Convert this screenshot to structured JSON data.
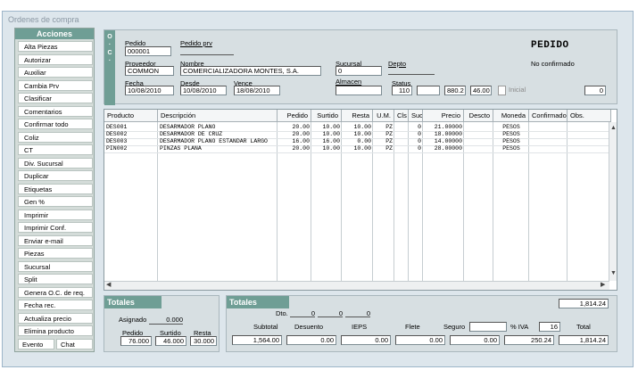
{
  "window_title": "Ordenes de compra",
  "sidebar": {
    "header": "Acciones",
    "items": [
      "Alta Piezas",
      "Autorizar",
      "Auxiliar",
      "Cambia Prv",
      "Clasificar",
      "Comentarios",
      "Confirmar todo",
      "Coliz",
      "CT",
      "Div. Sucursal",
      "Duplicar",
      "Etiquetas",
      "Gen %",
      "Imprimir",
      "Imprimir Conf.",
      "Enviar e-mail",
      "Piezas",
      "Sucursal",
      "Split",
      "Genera O.C. de req.",
      "Fecha rec.",
      "Actualiza precio",
      "Elimina producto"
    ],
    "bottom": [
      "Evento",
      "Chat"
    ]
  },
  "header": {
    "oc_letters": [
      "O",
      "C"
    ],
    "pedido_label": "Pedido",
    "pedido_value": "000001",
    "pedido_prv_label": "Pedido prv",
    "pedido_prv_value": "",
    "title": "PEDIDO",
    "proveedor_label": "Proveedor",
    "proveedor_value": "COMMON",
    "nombre_label": "Nombre",
    "nombre_value": "COMERCIALIZADORA MONTES, S.A.",
    "sucursal_label": "Sucursal",
    "sucursal_value": "0",
    "depto_label": "Depto",
    "depto_value": "",
    "status_text": "No confirmado",
    "fecha_label": "Fecha",
    "fecha_value": "10/08/2010",
    "desde_label": "Desde",
    "desde_value": "10/08/2010",
    "vence_label": "Vence",
    "vence_value": "18/08/2010",
    "almacen_label": "Almacen",
    "almacen_value": "",
    "status_label": "Status",
    "status_value": "110",
    "blank_value": "",
    "value_880": "880.2",
    "value_46": "46.00",
    "inicial_label": "Inicial",
    "right_value": "0"
  },
  "grid": {
    "columns": [
      "Producto",
      "Descripción",
      "Pedido",
      "Surtido",
      "Resta",
      "U.M.",
      "Cls",
      "Suc",
      "Precio",
      "Descto",
      "Moneda",
      "Confirmado",
      "Obs."
    ],
    "rows": [
      [
        "DES001",
        "DESARMADOR PLANO",
        "20.00",
        "10.00",
        "10.00",
        "PZ",
        "",
        "0",
        "21.00000",
        "",
        "PESOS",
        "",
        ""
      ],
      [
        "DES002",
        "DESARMADOR DE CRUZ",
        "20.00",
        "10.00",
        "10.00",
        "PZ",
        "",
        "0",
        "18.00000",
        "",
        "PESOS",
        "",
        ""
      ],
      [
        "DES003",
        "DESARMADOR PLANO ESTANDAR LARGO",
        "16.00",
        "16.00",
        "0.00",
        "PZ",
        "",
        "0",
        "14.00000",
        "",
        "PESOS",
        "",
        ""
      ],
      [
        "PIN002",
        "PINZAS PLANA",
        "20.00",
        "10.00",
        "10.00",
        "PZ",
        "",
        "0",
        "28.00000",
        "",
        "PESOS",
        "",
        ""
      ]
    ]
  },
  "totals_left": {
    "header": "Totales",
    "asignado_label": "Asignado",
    "asignado_value": "0.000",
    "pedido_label": "Pedido",
    "pedido_value": "76.000",
    "surtido_label": "Surtido",
    "surtido_value": "46.000",
    "resta_label": "Resta",
    "resta_value": "30.000"
  },
  "totals_right": {
    "header": "Totales",
    "top_total": "1,814.24",
    "dto_label": "Dto.",
    "dto_values": [
      "0",
      "0",
      "0"
    ],
    "labels": [
      "Subtotal",
      "Desuento",
      "IEPS",
      "Flete",
      "Seguro",
      "% IVA",
      "Total"
    ],
    "iva_pct": "16",
    "values": [
      "1,564.00",
      "0.00",
      "0.00",
      "0.00",
      "0.00",
      "250.24",
      "1,814.24"
    ]
  }
}
